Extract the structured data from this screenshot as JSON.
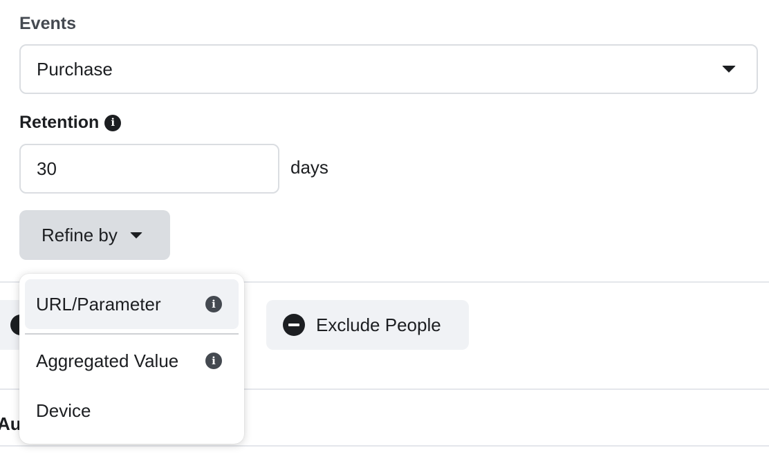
{
  "events": {
    "label": "Events",
    "selected": "Purchase"
  },
  "retention": {
    "label": "Retention",
    "value": "30",
    "unit": "days"
  },
  "refine": {
    "button_label": "Refine by",
    "menu_items": [
      {
        "label": "URL/Parameter",
        "icon": "info-icon"
      },
      {
        "label": "Aggregated Value",
        "icon": "info-icon"
      },
      {
        "label": "Device",
        "icon": ""
      }
    ]
  },
  "actions": {
    "exclude_label": "Exclude People"
  },
  "next_section": {
    "label_partial": "Au"
  },
  "colors": {
    "text": "#1c1e21",
    "border": "#dadde1",
    "button_bg": "#dadde1",
    "light_button_bg": "#f0f2f5"
  }
}
